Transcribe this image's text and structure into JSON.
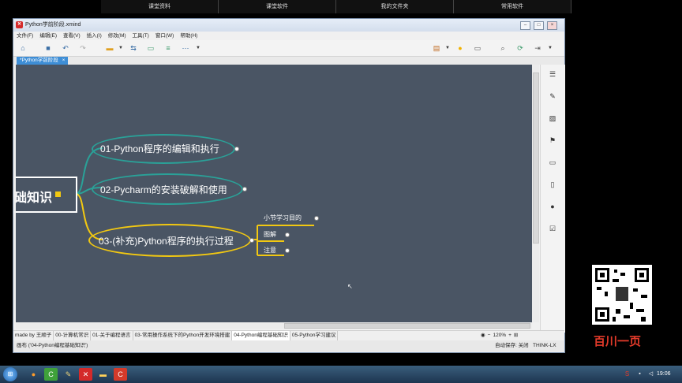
{
  "top_nav": [
    "课堂资料",
    "课堂软件",
    "我的文件夹",
    "常用软件"
  ],
  "window": {
    "title": "Python学前阶段.xmind",
    "app_icon": "xmind-icon",
    "controls": [
      "minimize-icon",
      "maximize-icon",
      "close-icon"
    ]
  },
  "menu": [
    "文件(F)",
    "编辑(E)",
    "查看(V)",
    "插入(I)",
    "修改(M)",
    "工具(T)",
    "窗口(W)",
    "帮助(H)"
  ],
  "toolbar_icons": [
    "home-icon",
    "save-icon",
    "undo-icon",
    "redo-icon",
    "folder-icon",
    "dropdown-icon",
    "relationship-icon",
    "boundary-icon",
    "summary-icon",
    "more-icon",
    "dropdown-icon",
    "presentation-icon",
    "dropdown-icon",
    "idea-bulb-icon",
    "image-icon",
    "search-icon",
    "share-icon",
    "export-icon",
    "dropdown-icon"
  ],
  "doc_tab": {
    "label": "*Python学前阶段",
    "close": "×"
  },
  "mindmap": {
    "central": {
      "label": "础知识"
    },
    "topics": [
      {
        "label": "01-Python程序的编辑和执行",
        "color": "#2aa198"
      },
      {
        "label": "02-Pycharm的安装破解和使用",
        "color": "#2aa198"
      },
      {
        "label": "03-(补充)Python程序的执行过程",
        "color": "#f2c811",
        "subtopics": [
          {
            "label": "小节学习目的"
          },
          {
            "label": "图解"
          },
          {
            "label": "注意"
          }
        ]
      }
    ]
  },
  "right_panel_icons": [
    "outline-icon",
    "format-brush-icon",
    "image-icon",
    "flag-icon",
    "note-icon",
    "document-icon",
    "comment-icon",
    "task-icon"
  ],
  "sheets": {
    "tabs": [
      "made by 王顺子",
      "00-计算机常识",
      "01-关于编程语言",
      "03-常用操作系统下的Python开发环境搭建",
      "04-Python编程基础知识",
      "05-Python学习建议"
    ],
    "active": 4
  },
  "zoom": {
    "value": "120%",
    "minus": "−",
    "plus": "+"
  },
  "status": {
    "canvas_label": "画布 ('04-Python编程基础知识')",
    "autosave": "自动保存: 关闭",
    "user": "THINK-LX"
  },
  "brand_text": "百川一页",
  "taskbar": {
    "clock": "19:06"
  },
  "colors": {
    "canvas_bg": "#4a5564",
    "teal": "#2aa198",
    "yellow": "#f2c811",
    "tab_blue": "#3e8ed6"
  }
}
